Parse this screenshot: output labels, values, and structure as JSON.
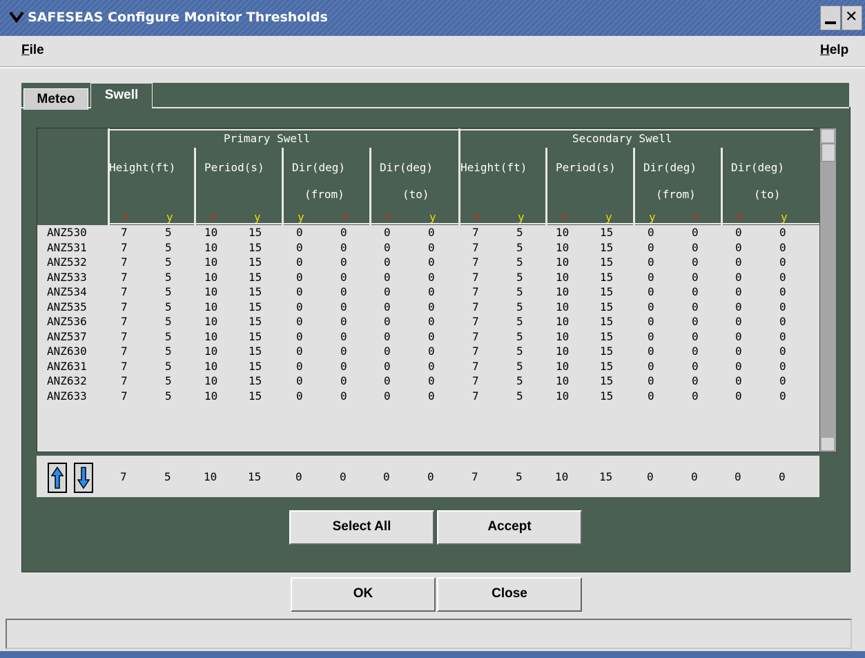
{
  "window": {
    "title": "SAFESEAS Configure Monitor Thresholds"
  },
  "menubar": {
    "file": "File",
    "help": "Help"
  },
  "tabs": [
    {
      "label": "Meteo"
    },
    {
      "label": "Swell"
    }
  ],
  "table": {
    "group_primary": "Primary Swell",
    "group_secondary": "Secondary Swell",
    "columns": [
      {
        "line1": "Height(ft)",
        "line2": "",
        "sub": [
          "r",
          "y"
        ]
      },
      {
        "line1": "Period(s)",
        "line2": "",
        "sub": [
          "r",
          "y"
        ]
      },
      {
        "line1": "Dir(deg)",
        "line2": "(from)",
        "sub": [
          "y",
          "r"
        ]
      },
      {
        "line1": "Dir(deg)",
        "line2": "(to)",
        "sub": [
          "r",
          "y"
        ]
      },
      {
        "line1": "Height(ft)",
        "line2": "",
        "sub": [
          "r",
          "y"
        ]
      },
      {
        "line1": "Period(s)",
        "line2": "",
        "sub": [
          "r",
          "y"
        ]
      },
      {
        "line1": "Dir(deg)",
        "line2": "(from)",
        "sub": [
          "y",
          "r"
        ]
      },
      {
        "line1": "Dir(deg)",
        "line2": "(to)",
        "sub": [
          "r",
          "y"
        ]
      }
    ],
    "rows": [
      {
        "zone": "ANZ530",
        "values": [
          "7",
          "5",
          "10",
          "15",
          "0",
          "0",
          "0",
          "0",
          "7",
          "5",
          "10",
          "15",
          "0",
          "0",
          "0",
          "0"
        ]
      },
      {
        "zone": "ANZ531",
        "values": [
          "7",
          "5",
          "10",
          "15",
          "0",
          "0",
          "0",
          "0",
          "7",
          "5",
          "10",
          "15",
          "0",
          "0",
          "0",
          "0"
        ]
      },
      {
        "zone": "ANZ532",
        "values": [
          "7",
          "5",
          "10",
          "15",
          "0",
          "0",
          "0",
          "0",
          "7",
          "5",
          "10",
          "15",
          "0",
          "0",
          "0",
          "0"
        ]
      },
      {
        "zone": "ANZ533",
        "values": [
          "7",
          "5",
          "10",
          "15",
          "0",
          "0",
          "0",
          "0",
          "7",
          "5",
          "10",
          "15",
          "0",
          "0",
          "0",
          "0"
        ]
      },
      {
        "zone": "ANZ534",
        "values": [
          "7",
          "5",
          "10",
          "15",
          "0",
          "0",
          "0",
          "0",
          "7",
          "5",
          "10",
          "15",
          "0",
          "0",
          "0",
          "0"
        ]
      },
      {
        "zone": "ANZ535",
        "values": [
          "7",
          "5",
          "10",
          "15",
          "0",
          "0",
          "0",
          "0",
          "7",
          "5",
          "10",
          "15",
          "0",
          "0",
          "0",
          "0"
        ]
      },
      {
        "zone": "ANZ536",
        "values": [
          "7",
          "5",
          "10",
          "15",
          "0",
          "0",
          "0",
          "0",
          "7",
          "5",
          "10",
          "15",
          "0",
          "0",
          "0",
          "0"
        ]
      },
      {
        "zone": "ANZ537",
        "values": [
          "7",
          "5",
          "10",
          "15",
          "0",
          "0",
          "0",
          "0",
          "7",
          "5",
          "10",
          "15",
          "0",
          "0",
          "0",
          "0"
        ]
      },
      {
        "zone": "ANZ630",
        "values": [
          "7",
          "5",
          "10",
          "15",
          "0",
          "0",
          "0",
          "0",
          "7",
          "5",
          "10",
          "15",
          "0",
          "0",
          "0",
          "0"
        ]
      },
      {
        "zone": "ANZ631",
        "values": [
          "7",
          "5",
          "10",
          "15",
          "0",
          "0",
          "0",
          "0",
          "7",
          "5",
          "10",
          "15",
          "0",
          "0",
          "0",
          "0"
        ]
      },
      {
        "zone": "ANZ632",
        "values": [
          "7",
          "5",
          "10",
          "15",
          "0",
          "0",
          "0",
          "0",
          "7",
          "5",
          "10",
          "15",
          "0",
          "0",
          "0",
          "0"
        ]
      },
      {
        "zone": "ANZ633",
        "values": [
          "7",
          "5",
          "10",
          "15",
          "0",
          "0",
          "0",
          "0",
          "7",
          "5",
          "10",
          "15",
          "0",
          "0",
          "0",
          "0"
        ]
      }
    ],
    "entry_values": [
      "7",
      "5",
      "10",
      "15",
      "0",
      "0",
      "0",
      "0",
      "7",
      "5",
      "10",
      "15",
      "0",
      "0",
      "0",
      "0"
    ]
  },
  "buttons": {
    "select_all": "Select All",
    "accept": "Accept",
    "ok": "OK",
    "close": "Close"
  },
  "colors": {
    "panel": "#4a6052",
    "red": "#e02020",
    "yellow": "#f0e000",
    "titlebar": "#4a6aa3"
  },
  "icons": {
    "up": "up-arrow-icon",
    "down": "down-arrow-icon"
  }
}
